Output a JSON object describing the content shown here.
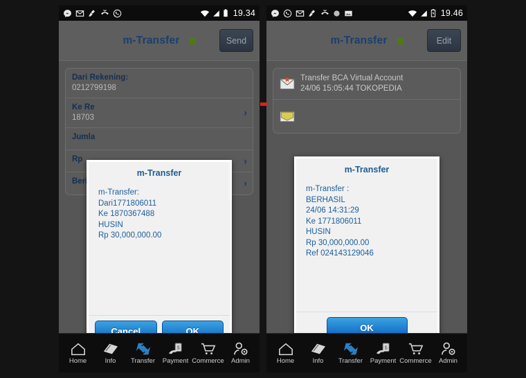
{
  "left_phone": {
    "status_bar": {
      "icons": [
        "messenger-icon",
        "gmail-icon",
        "cleaner-icon",
        "missed-call-icon",
        "whatsapp-icon"
      ],
      "signal_icons": [
        "wifi-icon",
        "cellular-signal-icon",
        "battery-icon"
      ],
      "clock": "19.34"
    },
    "header": {
      "title": "m-Transfer",
      "status_dot_color": "#4f7a12",
      "action_label": "Send"
    },
    "form": {
      "rows": [
        {
          "label": "Dari Rekening:",
          "value": "0212799198",
          "chevron": false
        },
        {
          "label": "Ke Re",
          "value": "18703",
          "chevron": true
        },
        {
          "label": "Jumla",
          "value": "",
          "chevron": false
        },
        {
          "label": "Rp",
          "value": "",
          "chevron": true
        },
        {
          "label": "Berita",
          "value": "",
          "chevron": true
        }
      ]
    },
    "dialog": {
      "title": "m-Transfer",
      "body": "m-Transfer:\nDari1771806011\nKe 1870367488\nHUSIN\nRp 30,000,000.00",
      "buttons": [
        "Cancel",
        "OK"
      ]
    },
    "nav": {
      "items": [
        {
          "label": "Home",
          "icon": "home-icon"
        },
        {
          "label": "Info",
          "icon": "book-icon"
        },
        {
          "label": "Transfer",
          "icon": "transfer-arrows-icon"
        },
        {
          "label": "Payment",
          "icon": "hand-money-icon"
        },
        {
          "label": "Commerce",
          "icon": "shopping-cart-icon"
        },
        {
          "label": "Admin",
          "icon": "user-gear-icon"
        }
      ]
    }
  },
  "right_phone": {
    "status_bar": {
      "icons": [
        "messenger-icon",
        "whatsapp-icon",
        "gmail-icon",
        "cleaner-icon",
        "missed-call-icon",
        "circle-icon",
        "photo-icon"
      ],
      "signal_icons": [
        "wifi-icon",
        "cellular-signal-icon",
        "battery-icon"
      ],
      "clock": "19.46"
    },
    "header": {
      "title": "m-Transfer",
      "status_dot_color": "#4f7a12",
      "action_label": "Edit"
    },
    "inbox": {
      "rows": [
        {
          "icon": "envelope-closed-icon",
          "title": "Transfer BCA Virtual Account",
          "subtitle": "24/06 15:05:44 TOKOPEDIA"
        },
        {
          "icon": "envelope-open-icon",
          "title": "",
          "subtitle": ""
        }
      ]
    },
    "dialog": {
      "title": "m-Transfer",
      "body": "m-Transfer :\nBERHASIL\n24/06 14:31:29\nKe 1771806011\nHUSIN\nRp 30,000,000.00\nRef 024143129046",
      "buttons": [
        "OK"
      ]
    },
    "nav": {
      "items": [
        {
          "label": "Home",
          "icon": "home-icon"
        },
        {
          "label": "Info",
          "icon": "book-icon"
        },
        {
          "label": "Transfer",
          "icon": "transfer-arrows-icon"
        },
        {
          "label": "Payment",
          "icon": "hand-money-icon"
        },
        {
          "label": "Commerce",
          "icon": "shopping-cart-icon"
        },
        {
          "label": "Admin",
          "icon": "user-gear-icon"
        }
      ]
    }
  }
}
